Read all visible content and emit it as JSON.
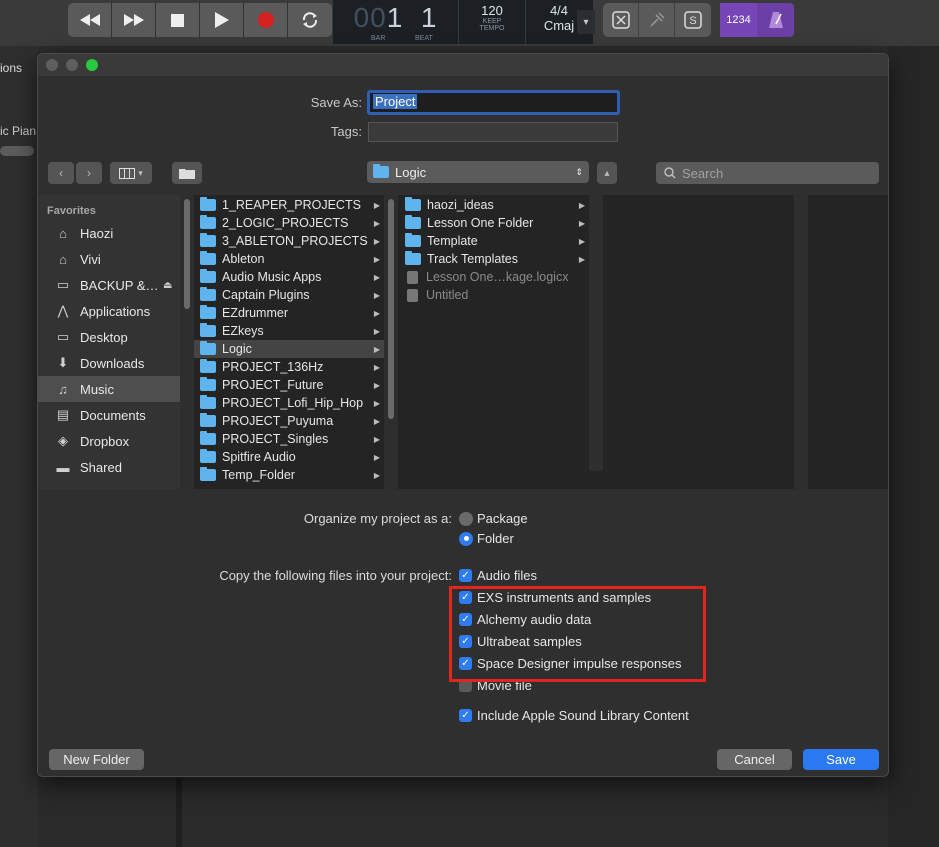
{
  "toolbar": {
    "lcd": {
      "bar_dim": "00",
      "bar": "1",
      "beat": "1",
      "bar_label": "BAR",
      "beat_label": "BEAT",
      "tempo": "120",
      "tempo_keep": "KEEP",
      "tempo_label": "TEMPO",
      "signature": "4/4",
      "key": "Cmaj"
    },
    "count_in": "1234"
  },
  "background": {
    "tab_fragment": "ions",
    "track_fragment": "ic Pian"
  },
  "dialog": {
    "save_as_label": "Save As:",
    "save_as_value": "Project",
    "tags_label": "Tags:",
    "location": "Logic",
    "search_placeholder": "Search",
    "sidebar": {
      "heading": "Favorites",
      "items": [
        {
          "label": "Haozi",
          "icon": "home-icon"
        },
        {
          "label": "Vivi",
          "icon": "home-icon"
        },
        {
          "label": "BACKUP &…",
          "icon": "drive-icon"
        },
        {
          "label": "Applications",
          "icon": "applications-icon"
        },
        {
          "label": "Desktop",
          "icon": "desktop-icon"
        },
        {
          "label": "Downloads",
          "icon": "downloads-icon"
        },
        {
          "label": "Music",
          "icon": "music-icon",
          "selected": true
        },
        {
          "label": "Documents",
          "icon": "documents-icon"
        },
        {
          "label": "Dropbox",
          "icon": "dropbox-icon"
        },
        {
          "label": "Shared",
          "icon": "shared-icon"
        }
      ]
    },
    "column1": [
      "1_REAPER_PROJECTS",
      "2_LOGIC_PROJECTS",
      "3_ABLETON_PROJECTS",
      "Ableton",
      "Audio Music Apps",
      "Captain Plugins",
      "EZdrummer",
      "EZkeys",
      "Logic",
      "PROJECT_136Hz",
      "PROJECT_Future",
      "PROJECT_Lofi_Hip_Hop",
      "PROJECT_Puyuma",
      "PROJECT_Singles",
      "Spitfire Audio",
      "Temp_Folder"
    ],
    "column2": [
      {
        "label": "haozi_ideas",
        "type": "folder"
      },
      {
        "label": "Lesson One Folder",
        "type": "folder"
      },
      {
        "label": "Template",
        "type": "folder"
      },
      {
        "label": "Track Templates",
        "type": "folder"
      },
      {
        "label": "Lesson One…kage.logicx",
        "type": "file"
      },
      {
        "label": "Untitled",
        "type": "file"
      }
    ],
    "organize_label": "Organize my project as a:",
    "organize_options": [
      {
        "label": "Package",
        "selected": false
      },
      {
        "label": "Folder",
        "selected": true
      }
    ],
    "copy_label": "Copy the following files into your project:",
    "copy_options": [
      {
        "label": "Audio files",
        "checked": true
      },
      {
        "label": "EXS instruments and samples",
        "checked": true
      },
      {
        "label": "Alchemy audio data",
        "checked": true
      },
      {
        "label": "Ultrabeat samples",
        "checked": true
      },
      {
        "label": "Space Designer impulse responses",
        "checked": true
      },
      {
        "label": "Movie file",
        "checked": false
      },
      {
        "label": "Include Apple Sound Library Content",
        "checked": true
      }
    ],
    "new_folder_label": "New Folder",
    "cancel_label": "Cancel",
    "save_label": "Save"
  },
  "colors": {
    "accent": "#2a79f2",
    "highlight_box": "#e0261f",
    "folder": "#5fb4ee",
    "count_in": "#7646b7"
  }
}
